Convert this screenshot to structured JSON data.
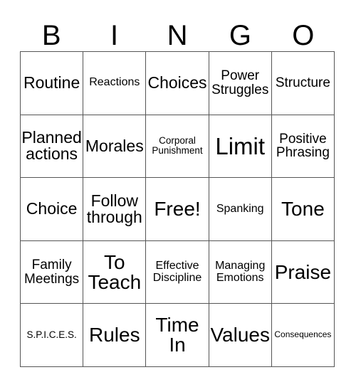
{
  "card": {
    "title": "BINGO",
    "header_letters": [
      "B",
      "I",
      "N",
      "G",
      "O"
    ],
    "free_space_label": "Free!",
    "colors": {
      "background": "#ffffff",
      "text": "#000000",
      "grid_line": "#555555"
    },
    "grid": {
      "columns": 5,
      "rows": 5,
      "cells": [
        [
          {
            "label": "Routine",
            "size": "xl"
          },
          {
            "label": "Reactions",
            "size": "md"
          },
          {
            "label": "Choices",
            "size": "xl"
          },
          {
            "label": "Power\nStruggles",
            "size": "lg"
          },
          {
            "label": "Structure",
            "size": "lg"
          }
        ],
        [
          {
            "label": "Planned\nactions",
            "size": "xl"
          },
          {
            "label": "Morales",
            "size": "xl"
          },
          {
            "label": "Corporal\nPunishment",
            "size": "sm"
          },
          {
            "label": "Limit",
            "size": "huge"
          },
          {
            "label": "Positive\nPhrasing",
            "size": "lg"
          }
        ],
        [
          {
            "label": "Choice",
            "size": "xl"
          },
          {
            "label": "Follow\nthrough",
            "size": "xl"
          },
          {
            "label": "Free!",
            "size": "xxl"
          },
          {
            "label": "Spanking",
            "size": "md"
          },
          {
            "label": "Tone",
            "size": "xxl"
          }
        ],
        [
          {
            "label": "Family\nMeetings",
            "size": "lg"
          },
          {
            "label": "To\nTeach",
            "size": "xxl"
          },
          {
            "label": "Effective\nDiscipline",
            "size": "md"
          },
          {
            "label": "Managing\nEmotions",
            "size": "md"
          },
          {
            "label": "Praise",
            "size": "xxl"
          }
        ],
        [
          {
            "label": "S.P.I.C.E.S.",
            "size": "sm"
          },
          {
            "label": "Rules",
            "size": "xxl"
          },
          {
            "label": "Time\nIn",
            "size": "xxl"
          },
          {
            "label": "Values",
            "size": "xxl"
          },
          {
            "label": "Consequences",
            "size": "xs"
          }
        ]
      ]
    }
  }
}
